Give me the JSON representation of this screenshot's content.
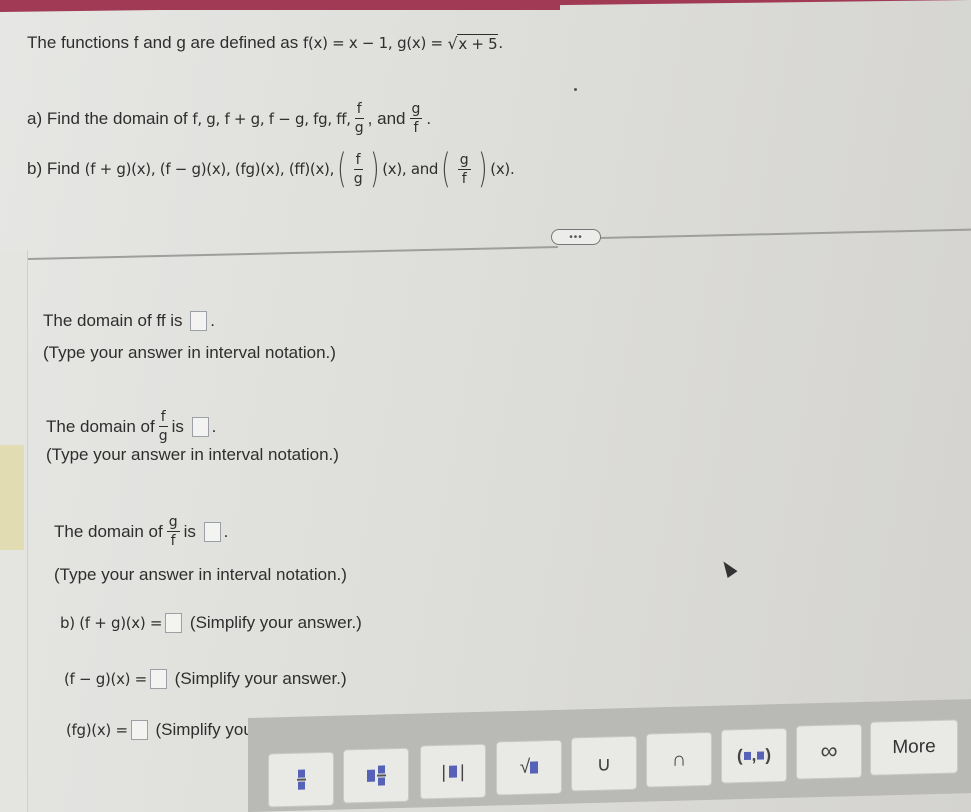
{
  "colors": {
    "top_bar": "#a03a55",
    "answer_box_border": "#9aa0a6",
    "toolbar_bg": "#b9b9b6",
    "template_square": "#5661b8"
  },
  "problem": {
    "intro_text": "The functions f and g are defined as",
    "f_def": "f(x) = x − 1,",
    "g_def_prefix": "g(x) =",
    "g_def_radicand": "x + 5",
    "g_def_suffix": ".",
    "part_a": {
      "prefix": "a) Find the domain of",
      "list": "f, g, f + g, f − g, fg, ff,",
      "frac1": {
        "num": "f",
        "den": "g"
      },
      "comma": ",",
      "and": "and",
      "frac2": {
        "num": "g",
        "den": "f"
      },
      "end": "."
    },
    "part_b": {
      "prefix": "b) Find",
      "list": "(f + g)(x), (f − g)(x), (fg)(x), (ff)(x),",
      "frac1": {
        "num": "f",
        "den": "g"
      },
      "x1": "(x), and",
      "frac2": {
        "num": "g",
        "den": "f"
      },
      "x2": "(x)."
    }
  },
  "expand_button": {
    "label": "•••"
  },
  "answers": {
    "domain_ff": {
      "prefix": "The domain of ff is",
      "suffix": ".",
      "hint": "(Type your answer in interval notation.)",
      "value": ""
    },
    "domain_f_over_g": {
      "prefix": "The domain of",
      "frac": {
        "num": "f",
        "den": "g"
      },
      "mid": "is",
      "suffix": ".",
      "hint": "(Type your answer in interval notation.)",
      "value": ""
    },
    "domain_g_over_f": {
      "prefix": "The domain of",
      "frac": {
        "num": "g",
        "den": "f"
      },
      "mid": "is",
      "suffix": ".",
      "hint": "(Type your answer in interval notation.)",
      "value": ""
    },
    "f_plus_g": {
      "label": "b) (f + g)(x) =",
      "hint": "(Simplify your answer.)",
      "value": ""
    },
    "f_minus_g": {
      "label": "(f − g)(x) =",
      "hint": "(Simplify your answer.)",
      "value": ""
    },
    "f_times_g": {
      "label": "(fg)(x) =",
      "hint": "(Simplify your answer.)",
      "value": ""
    }
  },
  "toolbar": {
    "buttons": [
      {
        "name": "fraction",
        "icon": "fraction-template-icon"
      },
      {
        "name": "mixed-number",
        "icon": "mixed-number-template-icon"
      },
      {
        "name": "absolute-value",
        "icon": "absolute-value-template-icon"
      },
      {
        "name": "square-root",
        "icon": "square-root-template-icon",
        "glyph": "√"
      },
      {
        "name": "union",
        "icon": "union-icon",
        "glyph": "∪"
      },
      {
        "name": "intersection",
        "icon": "intersection-icon",
        "glyph": "∩"
      },
      {
        "name": "interval",
        "icon": "interval-template-icon"
      },
      {
        "name": "infinity",
        "icon": "infinity-icon",
        "glyph": "∞"
      },
      {
        "name": "more",
        "label": "More"
      }
    ]
  }
}
